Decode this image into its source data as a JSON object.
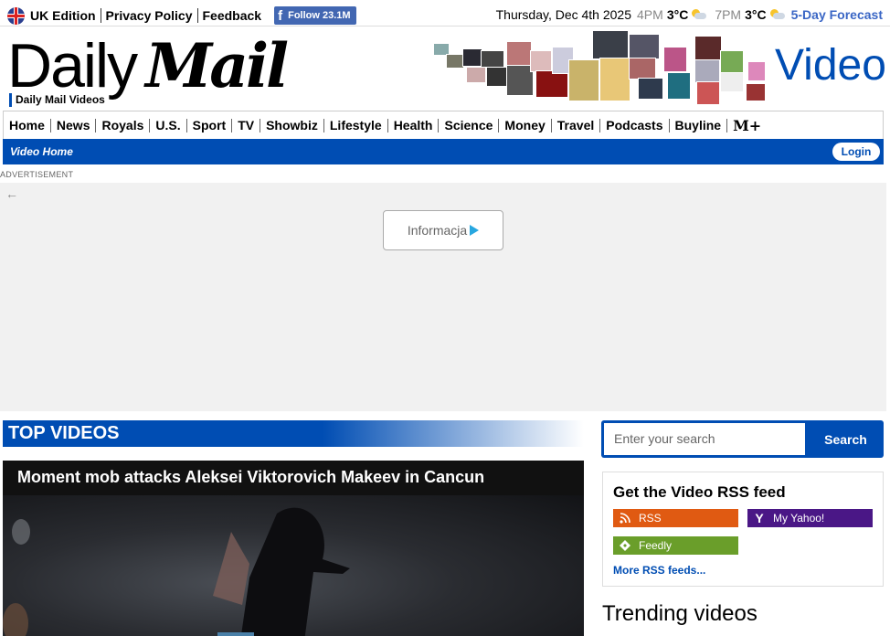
{
  "topbar": {
    "edition": "UK Edition",
    "privacy": "Privacy Policy",
    "feedback": "Feedback",
    "follow_label": "Follow",
    "follow_count": "23.1M",
    "date": "Thursday, Dec 4th 2025",
    "weather": [
      {
        "time": "4PM",
        "temp": "3°C",
        "icon": "partly-cloudy-icon"
      },
      {
        "time": "7PM",
        "temp": "3°C",
        "icon": "partly-cloudy-icon"
      }
    ],
    "forecast": "5-Day Forecast"
  },
  "logo": {
    "part1": "Daily",
    "part2": "Mail"
  },
  "subbrand": "Daily Mail Videos",
  "section_title": "Video",
  "nav": {
    "items": [
      "Home",
      "News",
      "Royals",
      "U.S.",
      "Sport",
      "TV",
      "Showbiz",
      "Lifestyle",
      "Health",
      "Science",
      "Money",
      "Travel",
      "Podcasts",
      "Buyline"
    ],
    "mplus": "M+"
  },
  "subnav": {
    "video_home": "Video Home",
    "login": "Login"
  },
  "ad": {
    "label": "ADVERTISEMENT",
    "info": "Informacja",
    "back_icon": "arrow-left-icon"
  },
  "top_videos": {
    "heading": "TOP VIDEOS",
    "featured_title": "Moment mob attacks Aleksei Viktorovich Makeev in Cancun"
  },
  "search": {
    "placeholder": "Enter your search",
    "button": "Search"
  },
  "rss": {
    "heading": "Get the Video RSS feed",
    "items": [
      {
        "label": "RSS",
        "color": "#e05a12",
        "icon": "rss-icon"
      },
      {
        "label": "My Yahoo!",
        "color": "#4a1786",
        "icon": "yahoo-icon"
      },
      {
        "label": "Feedly",
        "color": "#6a9e2a",
        "icon": "feedly-icon"
      }
    ],
    "more": "More RSS feeds..."
  },
  "trending": {
    "heading": "Trending videos"
  },
  "colors": {
    "brand_blue": "#004db3",
    "facebook": "#4267b2"
  }
}
